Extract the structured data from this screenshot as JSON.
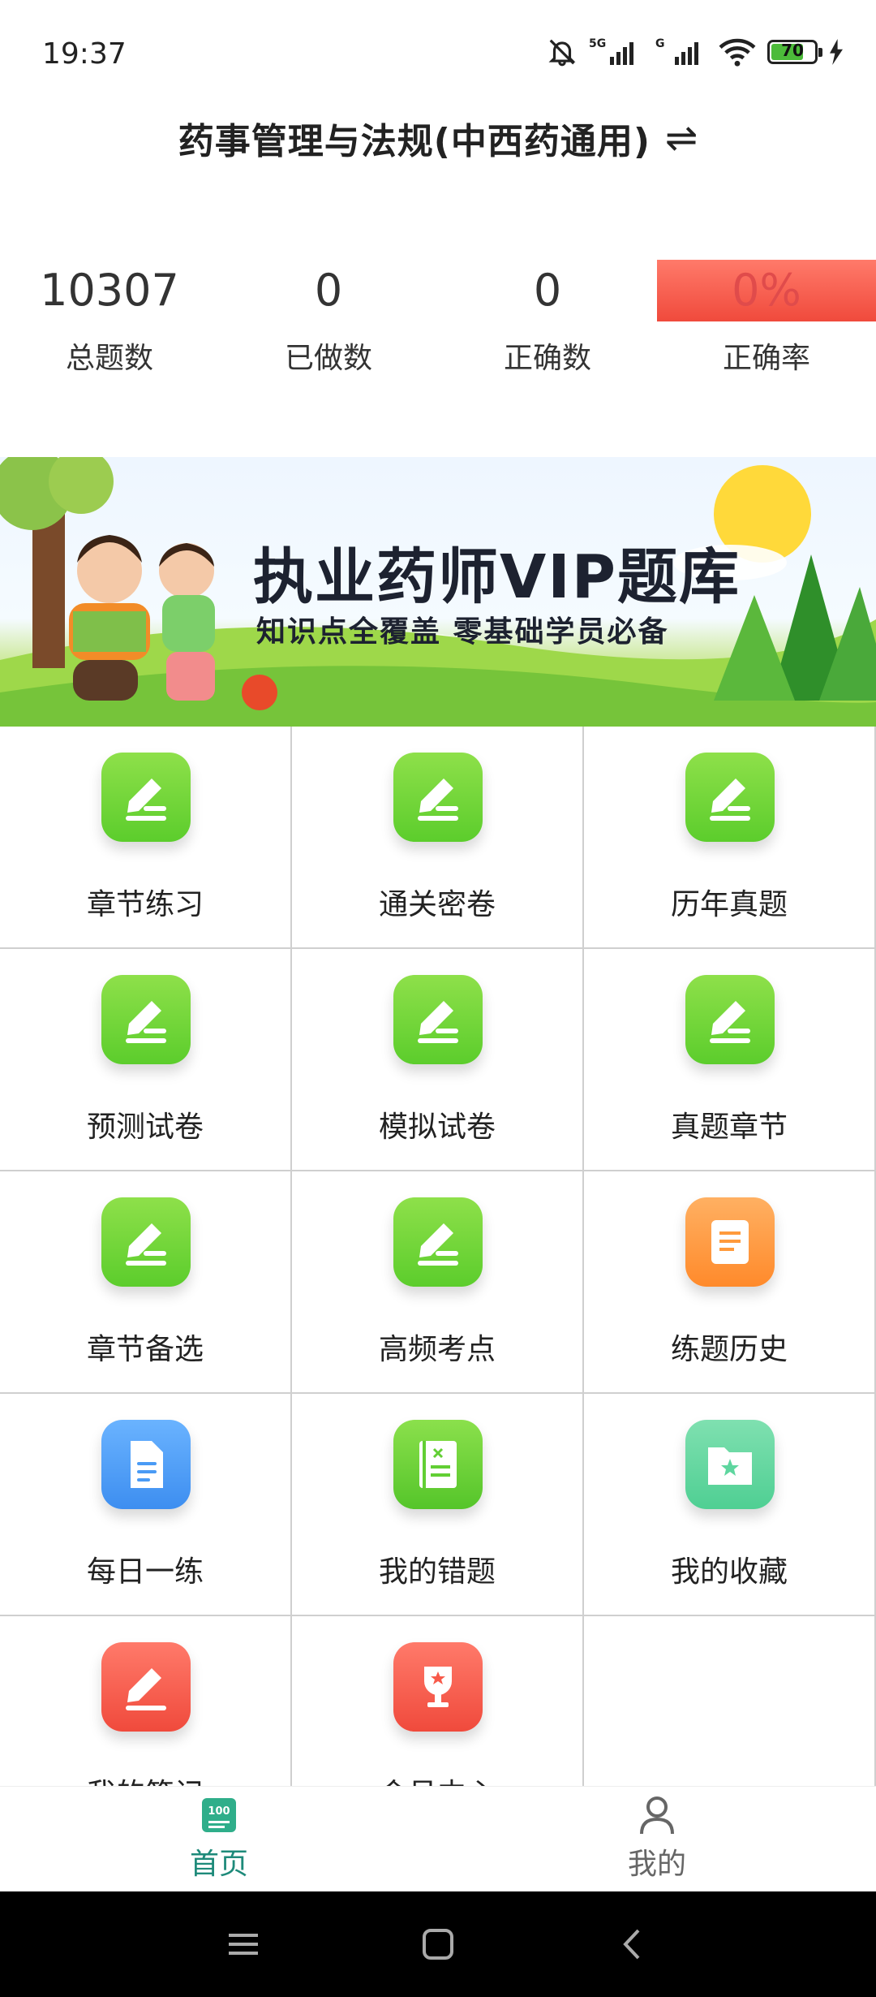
{
  "status_bar": {
    "time": "19:37",
    "battery": "70",
    "network_1": "5G",
    "network_2": "G"
  },
  "header": {
    "title": "药事管理与法规(中西药通用)",
    "switch_icon": "switch-arrows-icon"
  },
  "stats": [
    {
      "value": "10307",
      "label": "总题数"
    },
    {
      "value": "0",
      "label": "已做数"
    },
    {
      "value": "0",
      "label": "正确数"
    },
    {
      "value": "0%",
      "label": "正确率"
    }
  ],
  "banner": {
    "title": "执业药师VIP题库",
    "subtitle": "知识点全覆盖  零基础学员必备"
  },
  "grid": [
    {
      "label": "章节练习",
      "icon": "edit-icon",
      "color": "#6fd63a"
    },
    {
      "label": "通关密卷",
      "icon": "edit-icon",
      "color": "#6fd63a"
    },
    {
      "label": "历年真题",
      "icon": "edit-icon",
      "color": "#6fd63a"
    },
    {
      "label": "预测试卷",
      "icon": "edit-icon",
      "color": "#6fd63a"
    },
    {
      "label": "模拟试卷",
      "icon": "edit-icon",
      "color": "#6fd63a"
    },
    {
      "label": "真题章节",
      "icon": "edit-icon",
      "color": "#6fd63a"
    },
    {
      "label": "章节备选",
      "icon": "edit-icon",
      "color": "#6fd63a"
    },
    {
      "label": "高频考点",
      "icon": "edit-icon",
      "color": "#6fd63a"
    },
    {
      "label": "练题历史",
      "icon": "scroll-icon",
      "color": "#ff9a3c"
    },
    {
      "label": "每日一练",
      "icon": "document-icon",
      "color": "#4a9bf5"
    },
    {
      "label": "我的错题",
      "icon": "notebook-icon",
      "color": "#62cf34"
    },
    {
      "label": "我的收藏",
      "icon": "folder-star-icon",
      "color": "#5ed69f"
    },
    {
      "label": "我的笔记",
      "icon": "pencil-icon",
      "color": "#f85a4a"
    },
    {
      "label": "会员中心",
      "icon": "trophy-icon",
      "color": "#f85a4a"
    }
  ],
  "bottom_nav": [
    {
      "label": "首页",
      "icon": "home-100-icon",
      "active": true
    },
    {
      "label": "我的",
      "icon": "person-icon",
      "active": false
    }
  ],
  "colors": {
    "accent": "#1e8a7a",
    "rate_red": "#e04b4b"
  }
}
